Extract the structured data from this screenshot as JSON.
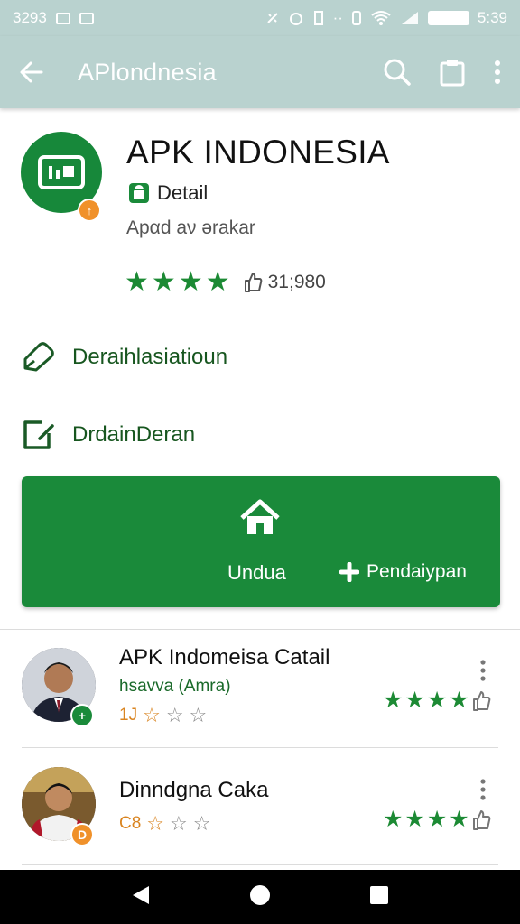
{
  "status_bar": {
    "time_left": "3293",
    "time_right": "5:39"
  },
  "app_bar": {
    "title": "APlondnesia",
    "icons": [
      "back-arrow-icon",
      "search-icon",
      "clipboard-icon",
      "more-vert-icon"
    ]
  },
  "app_header": {
    "name": "APK INDONESIA",
    "detail_label": "Detail",
    "subtitle": "Apαd aν ərakar",
    "rating_stars": 4,
    "review_count": "31;980"
  },
  "links": [
    {
      "label": "Deraihlasiatioun",
      "icon": "tag-icon"
    },
    {
      "label": "DrdainDeran",
      "icon": "edit-icon"
    }
  ],
  "download_card": {
    "primary_label": "Undua",
    "secondary_label": "Pendaiypan"
  },
  "list": [
    {
      "title": "APK Indomeisa Catail",
      "subtitle": "hsavva (Amra)",
      "count": "1J",
      "stars": 4,
      "badge": "+",
      "badge_color": "#1a8a3a"
    },
    {
      "title": "Dinndgna Caka",
      "subtitle": "",
      "count": "C8",
      "stars": 4,
      "badge": "D",
      "badge_color": "#f0912a"
    }
  ],
  "colors": {
    "primary_green": "#1a8a3a",
    "app_bar": "#b9d2cf",
    "accent_orange": "#f0912a"
  }
}
